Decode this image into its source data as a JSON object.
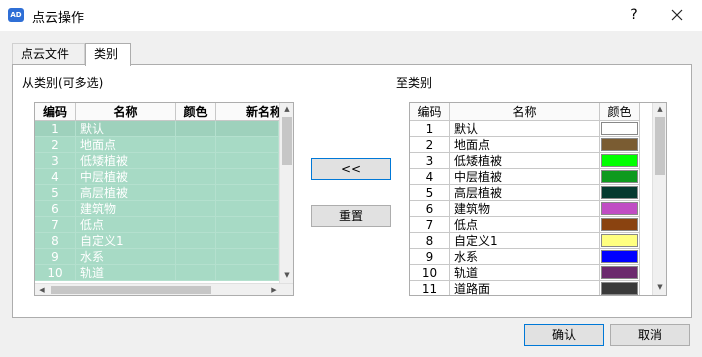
{
  "window": {
    "title": "点云操作",
    "icon_text": "AD",
    "help_label": "?"
  },
  "tabs": [
    {
      "label": "点云文件"
    },
    {
      "label": "类别"
    }
  ],
  "source": {
    "label": "从类别(可多选)",
    "headers": [
      "编码",
      "名称",
      "颜色",
      "新名称"
    ],
    "rows": [
      {
        "code": "1",
        "name": "默认"
      },
      {
        "code": "2",
        "name": "地面点"
      },
      {
        "code": "3",
        "name": "低矮植被"
      },
      {
        "code": "4",
        "name": "中层植被"
      },
      {
        "code": "5",
        "name": "高层植被"
      },
      {
        "code": "6",
        "name": "建筑物"
      },
      {
        "code": "7",
        "name": "低点"
      },
      {
        "code": "8",
        "name": "自定义1"
      },
      {
        "code": "9",
        "name": "水系"
      },
      {
        "code": "10",
        "name": "轨道"
      }
    ]
  },
  "target": {
    "label": "至类别",
    "headers": [
      "编码",
      "名称",
      "颜色"
    ],
    "rows": [
      {
        "code": "1",
        "name": "默认",
        "color": "#ffffff"
      },
      {
        "code": "2",
        "name": "地面点",
        "color": "#7a5c32"
      },
      {
        "code": "3",
        "name": "低矮植被",
        "color": "#00ff00"
      },
      {
        "code": "4",
        "name": "中层植被",
        "color": "#0e9a1e"
      },
      {
        "code": "5",
        "name": "高层植被",
        "color": "#053a2f"
      },
      {
        "code": "6",
        "name": "建筑物",
        "color": "#c04dc4"
      },
      {
        "code": "7",
        "name": "低点",
        "color": "#8a4310"
      },
      {
        "code": "8",
        "name": "自定义1",
        "color": "#ffff80"
      },
      {
        "code": "9",
        "name": "水系",
        "color": "#0000ff"
      },
      {
        "code": "10",
        "name": "轨道",
        "color": "#6c2a6e"
      },
      {
        "code": "11",
        "name": "道路面",
        "color": "#3a3a3a"
      }
    ]
  },
  "buttons": {
    "move_left": "<<",
    "reset": "重置",
    "confirm": "确认",
    "cancel": "取消"
  }
}
